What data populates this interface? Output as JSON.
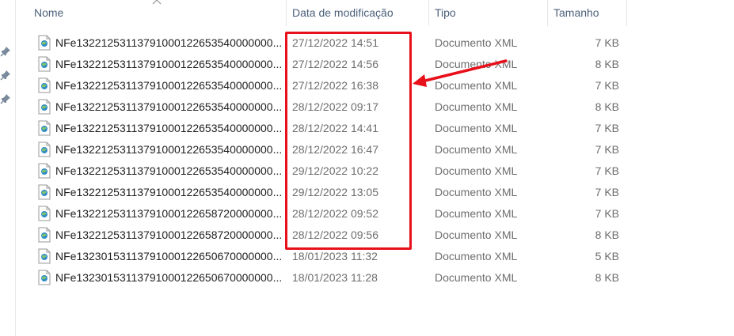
{
  "columns": {
    "name": "Nome",
    "date": "Data de modificação",
    "type": "Tipo",
    "size": "Tamanho"
  },
  "files": [
    {
      "name": "NFe13221253113791000122653540000000...",
      "date": "27/12/2022 14:51",
      "type": "Documento XML",
      "size": "7 KB"
    },
    {
      "name": "NFe13221253113791000122653540000000...",
      "date": "27/12/2022 14:56",
      "type": "Documento XML",
      "size": "8 KB"
    },
    {
      "name": "NFe13221253113791000122653540000000...",
      "date": "27/12/2022 16:38",
      "type": "Documento XML",
      "size": "7 KB"
    },
    {
      "name": "NFe13221253113791000122653540000000...",
      "date": "28/12/2022 09:17",
      "type": "Documento XML",
      "size": "8 KB"
    },
    {
      "name": "NFe13221253113791000122653540000000...",
      "date": "28/12/2022 14:41",
      "type": "Documento XML",
      "size": "7 KB"
    },
    {
      "name": "NFe13221253113791000122653540000000...",
      "date": "28/12/2022 16:47",
      "type": "Documento XML",
      "size": "7 KB"
    },
    {
      "name": "NFe13221253113791000122653540000000...",
      "date": "29/12/2022 10:22",
      "type": "Documento XML",
      "size": "7 KB"
    },
    {
      "name": "NFe13221253113791000122653540000000...",
      "date": "29/12/2022 13:05",
      "type": "Documento XML",
      "size": "7 KB"
    },
    {
      "name": "NFe13221253113791000122658720000000...",
      "date": "28/12/2022 09:52",
      "type": "Documento XML",
      "size": "7 KB"
    },
    {
      "name": "NFe13221253113791000122658720000000...",
      "date": "28/12/2022 09:56",
      "type": "Documento XML",
      "size": "8 KB"
    },
    {
      "name": "NFe13230153113791000122650670000000...",
      "date": "18/01/2023 11:32",
      "type": "Documento XML",
      "size": "5 KB"
    },
    {
      "name": "NFe13230153113791000122650670000000...",
      "date": "18/01/2023 11:28",
      "type": "Documento XML",
      "size": "8 KB"
    }
  ],
  "icons": {
    "pin": "pin-icon",
    "file": "xml-file-icon",
    "sort": "sort-ascending-icon"
  },
  "colors": {
    "annotation": "#e8101a",
    "header_text": "#4c607a"
  }
}
